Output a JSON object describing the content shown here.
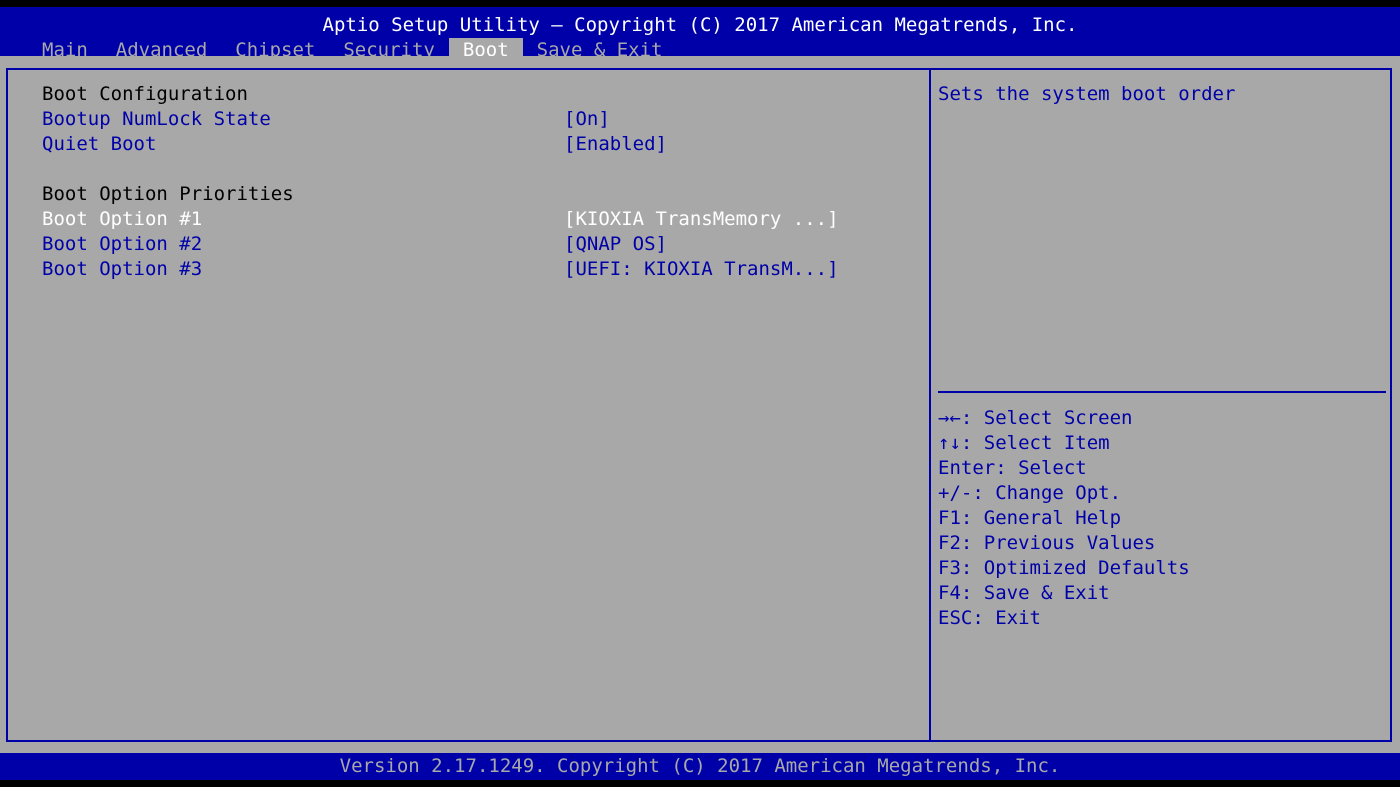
{
  "header": {
    "title": "Aptio Setup Utility – Copyright (C) 2017 American Megatrends, Inc.",
    "tabs": [
      {
        "label": "Main"
      },
      {
        "label": "Advanced"
      },
      {
        "label": "Chipset"
      },
      {
        "label": "Security"
      },
      {
        "label": "Boot",
        "active": true
      },
      {
        "label": "Save & Exit"
      }
    ]
  },
  "main": {
    "section1": "Boot Configuration",
    "settings": [
      {
        "label": "Bootup NumLock State",
        "value": "[On]"
      },
      {
        "label": "Quiet Boot",
        "value": "[Enabled]"
      }
    ],
    "section2": "Boot Option Priorities",
    "boot_options": [
      {
        "label": "Boot Option #1",
        "value": "[KIOXIA TransMemory ...]",
        "selected": true
      },
      {
        "label": "Boot Option #2",
        "value": "[QNAP OS]"
      },
      {
        "label": "Boot Option #3",
        "value": "[UEFI: KIOXIA TransM...]"
      }
    ]
  },
  "help": {
    "description": "Sets the system boot order",
    "keys": [
      "→←: Select Screen",
      "↑↓: Select Item",
      "Enter: Select",
      "+/-: Change Opt.",
      "F1: General Help",
      "F2: Previous Values",
      "F3: Optimized Defaults",
      "F4: Save & Exit",
      "ESC: Exit"
    ]
  },
  "footer": {
    "version": "Version 2.17.1249. Copyright (C) 2017 American Megatrends, Inc."
  },
  "colors": {
    "blue": "#0000a8",
    "gray": "#a8a8a8",
    "white": "#ffffff",
    "black": "#000000"
  }
}
